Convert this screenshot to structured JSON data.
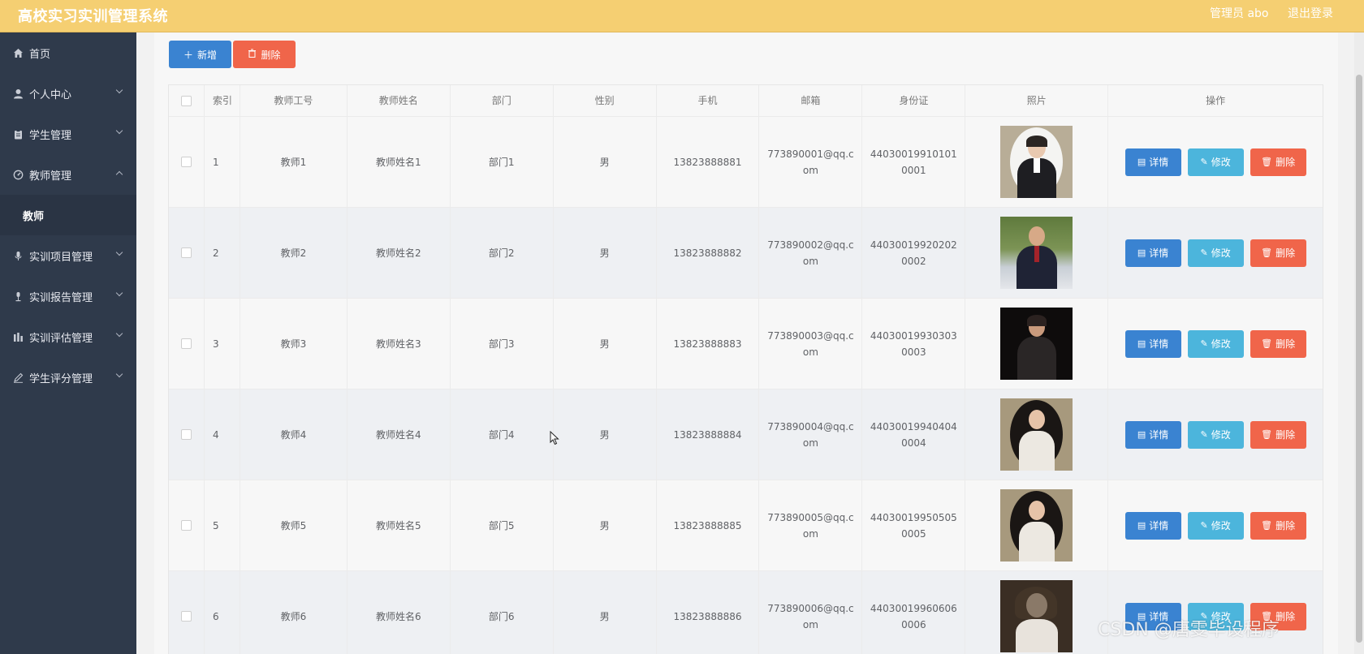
{
  "header": {
    "app_title": "高校实习实训管理系统",
    "user_label": "管理员 abo",
    "logout_label": "退出登录"
  },
  "sidebar": {
    "items": [
      {
        "label": "首页",
        "icon": "home-icon"
      },
      {
        "label": "个人中心",
        "icon": "user-icon"
      },
      {
        "label": "学生管理",
        "icon": "clipboard-icon"
      },
      {
        "label": "教师管理",
        "icon": "gauge-icon"
      },
      {
        "label": "教师",
        "icon": ""
      },
      {
        "label": "实训项目管理",
        "icon": "microphone-icon"
      },
      {
        "label": "实训报告管理",
        "icon": "mic-stand-icon"
      },
      {
        "label": "实训评估管理",
        "icon": "bar-chart-icon"
      },
      {
        "label": "学生评分管理",
        "icon": "pen-icon"
      }
    ]
  },
  "toolbar": {
    "add_label": "新增",
    "delete_label": "删除"
  },
  "table": {
    "columns": [
      "索引",
      "教师工号",
      "教师姓名",
      "部门",
      "性别",
      "手机",
      "邮箱",
      "身份证",
      "照片",
      "操作"
    ],
    "rows": [
      {
        "idx": "1",
        "no": "教师1",
        "name": "教师姓名1",
        "dept": "部门1",
        "sex": "男",
        "phone": "13823888881",
        "email": "773890001@qq.com",
        "id_card": "440300199101010001"
      },
      {
        "idx": "2",
        "no": "教师2",
        "name": "教师姓名2",
        "dept": "部门2",
        "sex": "男",
        "phone": "13823888882",
        "email": "773890002@qq.com",
        "id_card": "440300199202020002"
      },
      {
        "idx": "3",
        "no": "教师3",
        "name": "教师姓名3",
        "dept": "部门3",
        "sex": "男",
        "phone": "13823888883",
        "email": "773890003@qq.com",
        "id_card": "440300199303030003"
      },
      {
        "idx": "4",
        "no": "教师4",
        "name": "教师姓名4",
        "dept": "部门4",
        "sex": "男",
        "phone": "13823888884",
        "email": "773890004@qq.com",
        "id_card": "440300199404040004"
      },
      {
        "idx": "5",
        "no": "教师5",
        "name": "教师姓名5",
        "dept": "部门5",
        "sex": "男",
        "phone": "13823888885",
        "email": "773890005@qq.com",
        "id_card": "440300199505050005"
      },
      {
        "idx": "6",
        "no": "教师6",
        "name": "教师姓名6",
        "dept": "部门6",
        "sex": "男",
        "phone": "13823888886",
        "email": "773890006@qq.com",
        "id_card": "440300199606060006"
      }
    ],
    "ops": {
      "detail_label": "详情",
      "edit_label": "修改",
      "delete_label": "删除"
    }
  },
  "watermark": "CSDN @唐雯毕设程序",
  "colors": {
    "header_bg": "#f5cf72",
    "sidebar_bg": "#2f3a4b",
    "primary": "#3a83d1",
    "info": "#4cb5dc",
    "danger": "#f0654a"
  }
}
